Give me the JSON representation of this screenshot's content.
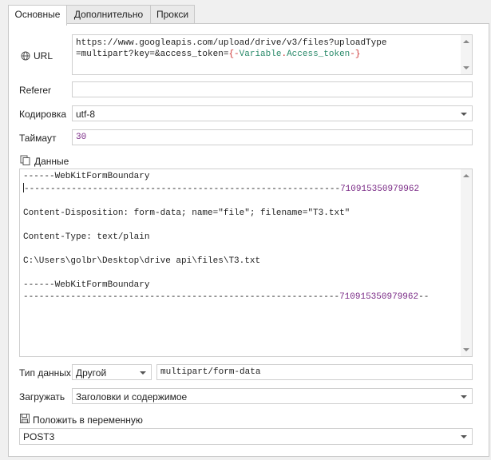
{
  "tabs": [
    {
      "label": "Основные"
    },
    {
      "label": "Дополнительно"
    },
    {
      "label": "Прокси"
    }
  ],
  "url": {
    "label": "URL",
    "line1": "https://www.googleapis.com/upload/drive/v3/files?uploadType",
    "line2_prefix": "=multipart?key=&access_token=",
    "var_open": "{-",
    "var_scope": "Variable",
    "var_dot": ".",
    "var_name": "Access_token",
    "var_close": "-}"
  },
  "referer": {
    "label": "Referer",
    "value": ""
  },
  "encoding": {
    "label": "Кодировка",
    "value": "utf-8"
  },
  "timeout": {
    "label": "Таймаут",
    "value": "30"
  },
  "data": {
    "label": "Данные",
    "lines": [
      {
        "text": "------WebKitFormBoundary",
        "num": ""
      },
      {
        "text": "------------------------------------------------------------",
        "num": "710915350979962",
        "cursor": true
      },
      {
        "text": "",
        "num": ""
      },
      {
        "text": "Content-Disposition: form-data; name=\"file\"; filename=\"T3.txt\"",
        "num": ""
      },
      {
        "text": "",
        "num": ""
      },
      {
        "text": "Content-Type: text/plain",
        "num": ""
      },
      {
        "text": "",
        "num": ""
      },
      {
        "text": "C:\\Users\\golbr\\Desktop\\drive api\\files\\T3.txt",
        "num": ""
      },
      {
        "text": "",
        "num": ""
      },
      {
        "text": "------WebKitFormBoundary",
        "num": ""
      },
      {
        "text": "------------------------------------------------------------",
        "num": "710915350979962",
        "suffix": "--"
      }
    ]
  },
  "data_type": {
    "label": "Тип данных",
    "value": "Другой",
    "content_type": "multipart/form-data"
  },
  "load": {
    "label": "Загружать",
    "value": "Заголовки и содержимое"
  },
  "save_to": {
    "label": "Положить в переменную",
    "value": "POST3"
  }
}
